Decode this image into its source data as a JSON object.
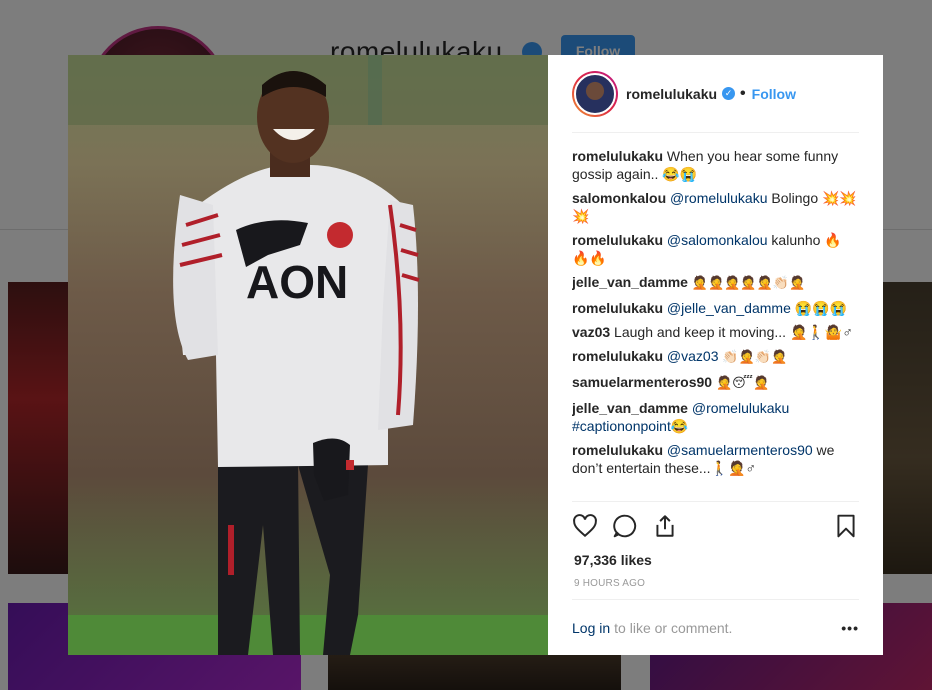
{
  "background": {
    "username": "romelulukaku",
    "follow_label": "Follow"
  },
  "post": {
    "username": "romelulukaku",
    "verified": true,
    "separator": "•",
    "follow_label": "Follow",
    "photo_alt": "Romelu Lukaku laughing in a white Manchester United AON training top",
    "comments": [
      {
        "user": "romelulukaku",
        "mention": "",
        "text": "When you hear some funny gossip again.. 😂😭"
      },
      {
        "user": "salomonkalou",
        "mention": "@romelulukaku",
        "text": "Bolingo 💥💥💥"
      },
      {
        "user": "romelulukaku",
        "mention": "@salomonkalou",
        "text": "kalunho 🔥🔥🔥"
      },
      {
        "user": "jelle_van_damme",
        "mention": "",
        "text": "🤦🤦🤦🤦🤦👏🏻🤦"
      },
      {
        "user": "romelulukaku",
        "mention": "@jelle_van_damme",
        "text": "😭😭😭"
      },
      {
        "user": "vaz03",
        "mention": "",
        "text": "Laugh and keep it moving... 🤦🚶🤷♂"
      },
      {
        "user": "romelulukaku",
        "mention": "@vaz03",
        "text": "👏🏻🤦👏🏻🤦"
      },
      {
        "user": "samuelarmenteros90",
        "mention": "",
        "text": "🤦😴🤦"
      },
      {
        "user": "jelle_van_damme",
        "mention": "@romelulukaku",
        "text": "#captiononpoint😂"
      },
      {
        "user": "romelulukaku",
        "mention": "@samuelarmenteros90",
        "text": "we don’t entertain these...🚶🤦♂"
      }
    ],
    "likes": "97,336 likes",
    "time": "9 HOURS AGO",
    "login_link": "Log in",
    "login_text": "to like or comment.",
    "more_label": "•••"
  },
  "colors": {
    "accent": "#3897f0",
    "link": "#003569",
    "muted": "#999999"
  },
  "icons": [
    "heart-icon",
    "comment-icon",
    "share-icon",
    "bookmark-icon",
    "verified-badge-icon",
    "more-options-icon"
  ]
}
